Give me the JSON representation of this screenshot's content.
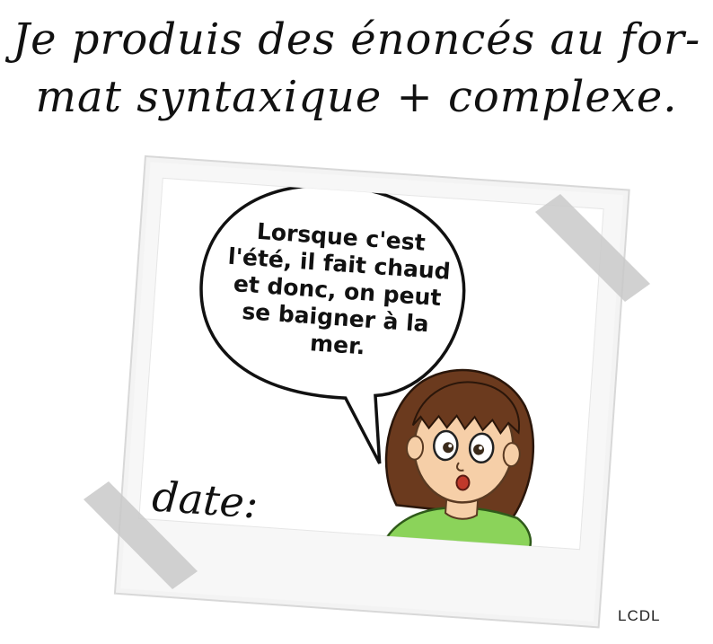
{
  "title": {
    "line1": "Je produis des énoncés au for-",
    "line2": "mat syntaxique + complexe."
  },
  "speech_bubble": {
    "lines": [
      "Lorsque c'est",
      "l'été, il fait chaud",
      "et donc, on peut",
      "se baigner à la",
      "mer."
    ]
  },
  "date_label": "date:",
  "signature": "LCDL",
  "colors": {
    "tape": "#c9c9c9",
    "frame": "#f4f4f4",
    "photo_bg": "#ffffff",
    "hair": "#6b3a1e",
    "skin": "#f6cfa8",
    "shirt": "#8bd35a"
  }
}
